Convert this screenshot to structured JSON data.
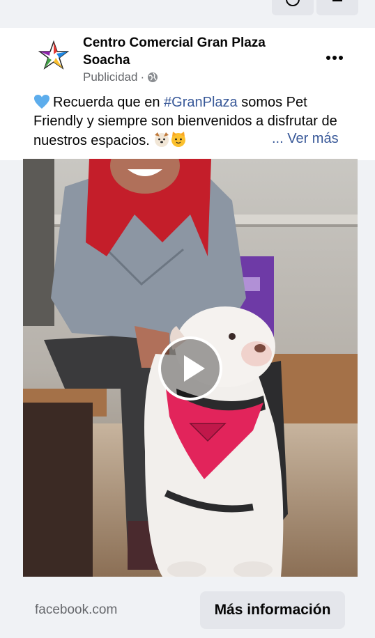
{
  "post": {
    "page_name": "Centro Comercial Gran Plaza Soacha",
    "sponsored_label": "Publicidad",
    "separator": "·",
    "text_before_hashtag": "Recuerda que en ",
    "hashtag": "#GranPlaza",
    "text_after_hashtag": " somos Pet Friendly y siempre son bienvenidos a disfrutar de nuestros espacios.",
    "see_more": "... Ver más"
  },
  "icons": {
    "heart": "blue-heart-emoji",
    "dog": "dog-face-emoji",
    "cat": "cat-face-emoji",
    "globe": "globe-icon",
    "more": "more-options-icon",
    "play": "play-icon"
  },
  "footer": {
    "domain": "facebook.com",
    "cta_label": "Más información"
  },
  "colors": {
    "link": "#385898",
    "secondary_text": "#65676b",
    "button_bg": "#e4e6eb"
  }
}
